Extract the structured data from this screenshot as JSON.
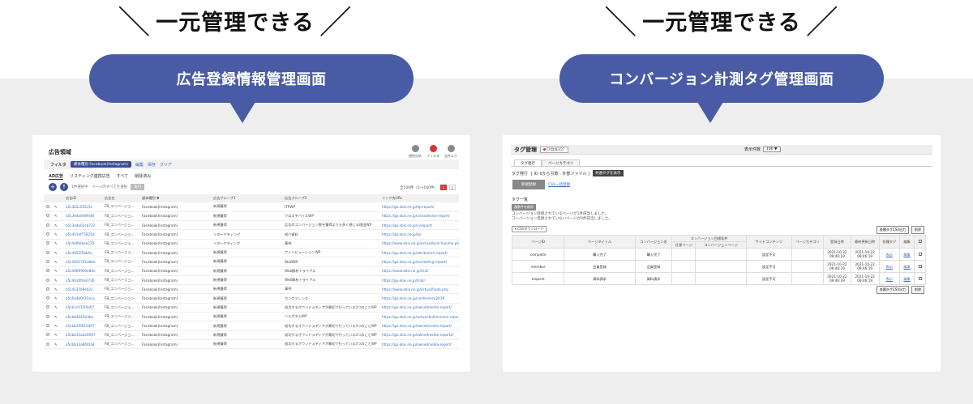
{
  "left": {
    "slogan": "一元管理できる",
    "bubble": "広告登録情報管理画面",
    "panel": {
      "title": "広告領域",
      "toolbar_icons": [
        {
          "name": "analytics-icon",
          "label": "個別分析"
        },
        {
          "name": "filter-icon",
          "label": "フィルタ"
        },
        {
          "name": "export-icon",
          "label": "全件エクスポート"
        }
      ],
      "filter": {
        "label": "フィルタ",
        "chip": "媒体種別 Facebook(Instagram)",
        "edit": "編集",
        "save": "保存",
        "clear": "クリア"
      },
      "tabs": [
        "AD広告",
        "リスティング連携広告",
        "すべて",
        "削除済み"
      ],
      "actions": {
        "page_hint": "1件選択中",
        "select_all": "ページ内すべてを選択",
        "apply": "実行"
      },
      "pagination": {
        "summary": "全100件（1〜100件）",
        "pages": [
          "1",
          "2"
        ]
      },
      "columns": [
        "",
        "",
        "広告ID",
        "広告名",
        "媒体種別 ▼",
        "広告グループ1",
        "広告グループ2",
        "リンク先URL"
      ],
      "rows": [
        {
          "id": "a5c3b5c035c5c",
          "name": "FB_コンバージョ…",
          "media": "Facebook(Instagram)",
          "g1": "新規獲得",
          "g2": "ITPWP",
          "url": "https://go.ebis.ne.jp/itp-report/"
        },
        {
          "id": "a5c3eda0e8fe46",
          "name": "FB_コンバージョ…",
          "media": "Facebook(Instagram)",
          "g1": "新規獲得",
          "g2": "クロスデバイスWP",
          "url": "https://go.ebis.ne.jp/crossdevice-report/"
        },
        {
          "id": "a5c3eda02cb722",
          "name": "FB_コンバージョ…",
          "media": "Facebook(Instagram)",
          "g1": "新規獲得",
          "g2": "広告のコンバージョン数を獲得よりも多く感じる理由WP",
          "url": "https://go.ebis.ne.jp/cvreport/"
        },
        {
          "id": "a5c401ef75825d",
          "name": "FB_コンバージョ…",
          "media": "Facebook(Instagram)",
          "g1": "リターゲティング",
          "g2": "紹介資料",
          "url": "https://go.ebis.ne.jp/lp/"
        },
        {
          "id": "a5c4ef8daee235",
          "name": "FB_コンバージョ…",
          "media": "Facebook(Instagram)",
          "g1": "リターゲティング",
          "g2": "事例",
          "url": "https://www.ebis.ne.jp/actual/bulk-hanime.php"
        },
        {
          "id": "a5c4652f5bb5a",
          "name": "FB_コンバージョ…",
          "media": "Facebook(Instagram)",
          "g1": "新規獲得",
          "g2": "アトリビューションWP",
          "url": "https://go.ebis.ne.jp/attribution-report/"
        },
        {
          "id": "a5c4652741a6be",
          "name": "FB_コンバージョ…",
          "media": "Facebook(Instagram)",
          "g1": "新規獲得",
          "g2": "BtoBWP",
          "url": "https://go.ebis.ne.jp/marketing-report/"
        },
        {
          "id": "a5c4669900e84e",
          "name": "FB_コンバージョ…",
          "media": "Facebook(Instagram)",
          "g1": "新規獲得",
          "g2": "Web解析トライアル",
          "url": "https://www.ebis.ne.jp/trial/"
        },
        {
          "id": "a5c4610f4e072b",
          "name": "FB_コンバージョ…",
          "media": "Facebook(Instagram)",
          "g1": "新規獲得",
          "g2": "Web解析トライアル",
          "url": "https://go.ebis.ne.jp/trial/"
        },
        {
          "id": "a5c4e3569eb2c",
          "name": "FB_コンバージョ…",
          "media": "Facebook(Instagram)",
          "g1": "新規獲得",
          "g2": "事例",
          "url": "https://www.ebis.ne.jp/actual/hada.php"
        },
        {
          "id": "a5c6a4b0c33aca",
          "name": "FB_コンバージョン",
          "media": "Facebook(Instagram)",
          "g1": "新規獲得",
          "g2": "カンファレンス",
          "url": "https://go.ebis.ne.jp/conference2019"
        },
        {
          "id": "a5cb1c01f20a07",
          "name": "FB_コンバージョ…",
          "media": "Facebook(Instagram)",
          "g1": "新規獲得",
          "g2": "成功するオウンドメディアが最初で行っている3つのことWP",
          "url": "https://go.ebis.ne.jp/ownedmedia-report/"
        },
        {
          "id": "a5cbb4045a3ba",
          "name": "FB_コンバージョ…",
          "media": "Facebook(Instagram)",
          "g1": "新規獲得",
          "g2": "ハルボネムWP",
          "url": "https://go.ebis.ne.jp/actual-bulkhonime-report/"
        },
        {
          "id": "a5cbb2f0010307",
          "name": "FB_コンバージョ…",
          "media": "Facebook(Instagram)",
          "g1": "新規獲得",
          "g2": "成功するオウンドメディアが最初で行っている3つのことWP",
          "url": "https://go.ebis.ne.jp/ownedmedia-report/"
        },
        {
          "id": "a5cbb33aae0007",
          "name": "FB_コンバージョ…",
          "media": "Facebook(Instagram)",
          "g1": "新規獲得",
          "g2": "成功するオウンドメディアが最初で行っている3つのことWP",
          "url": "https://go.ebis.ne.jp/ownedmedia-report2/"
        },
        {
          "id": "a5cbb33a8f40a4",
          "name": "FB_コンバージョ…",
          "media": "Facebook(Instagram)",
          "g1": "新規獲得",
          "g2": "成功するオウンドメディアが最初で行っている3つのことWP",
          "url": "https://go.ebis.ne.jp/ownedmedia-report/"
        }
      ]
    }
  },
  "right": {
    "slogan": "一元管理できる",
    "bubble": "コンバージョン計測タグ管理画面",
    "panel": {
      "title": "タグ管理",
      "badge": "CV登録3/27",
      "count_label": "表示件数",
      "count_value": "100 ▼",
      "tabs": [
        "タグ発行",
        "ページカテゴリ"
      ],
      "issue_label": "タグ発行",
      "issue_detail": "[ ID 0から引数 : 外部ファイル ]",
      "common_tag_btn": "共通タグを表示",
      "new_btn": "新規登録",
      "csv_link": "CSV一括登録",
      "list_label": "タグ一覧",
      "bulk_btn": "複数件を削除",
      "note1": "コンバージョン登録されているページが1件該当しました。",
      "note2": "コンバージョン登録されていないページが0件該当しました。",
      "download": "▾ CSVダウンロード",
      "btn_csv": "各種タグCSV出力",
      "btn_delete": "削除",
      "columns": [
        "ページID",
        "ページタイトル",
        "コンバージョン名",
        "コンバージョン目標条件",
        "",
        "サイトコンテンツ",
        "ページカテゴリ",
        "登録日時",
        "最終更新日時",
        "各種タグ",
        "編集",
        ""
      ],
      "subcolumns": [
        "任意ページ",
        "コンバージョンページ"
      ],
      "rows": [
        {
          "pid": "complete",
          "title": "購入完了",
          "cv": "購入完了",
          "content": "設定不可",
          "reg": "2021-10-22 09:46:19",
          "upd": "2021-10-22 09:46:19",
          "tag": "表示",
          "edit": "編集"
        },
        {
          "pid": "member",
          "title": "会員登録",
          "cv": "会員登録",
          "content": "設定不可",
          "reg": "2021-10-22 09:46:19",
          "upd": "2021-10-22 09:46:19",
          "tag": "表示",
          "edit": "編集"
        },
        {
          "pid": "request",
          "title": "資料請求",
          "cv": "資料請求",
          "content": "設定不可",
          "reg": "2021-10-22 09:46:19",
          "upd": "2021-10-22 09:46:19",
          "tag": "表示",
          "edit": "編集"
        }
      ]
    }
  }
}
